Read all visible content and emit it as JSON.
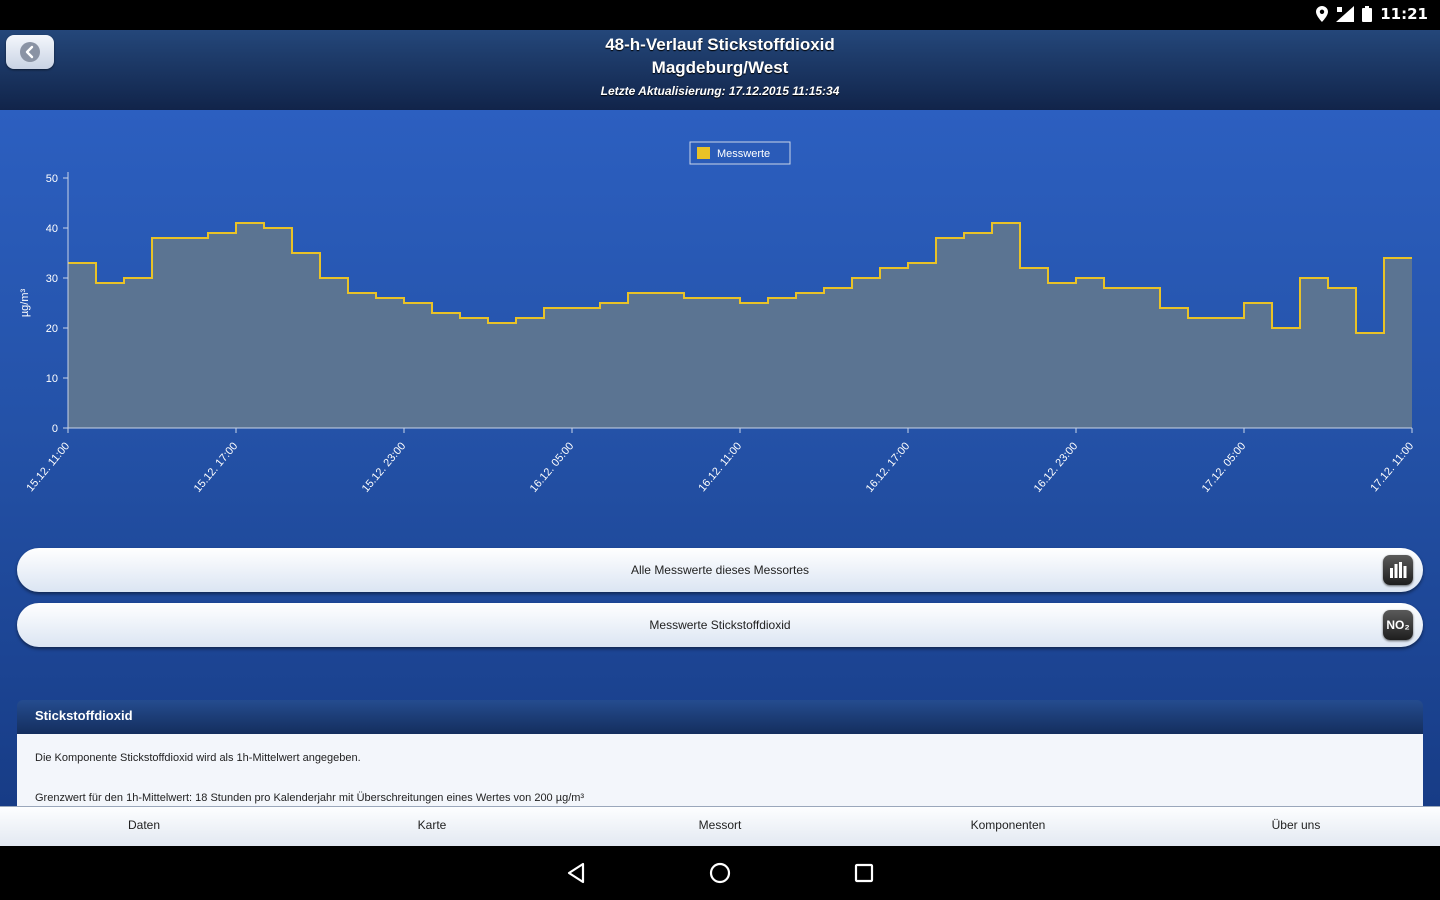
{
  "status_bar": {
    "time": "11:21",
    "icons": [
      "location-icon",
      "signal-icon",
      "battery-icon"
    ]
  },
  "header": {
    "title_line1": "48-h-Verlauf Stickstoffdioxid",
    "title_line2": "Magdeburg/West",
    "last_update": "Letzte Aktualisierung: 17.12.2015 11:15:34",
    "back_icon": "back-arrow-icon"
  },
  "chart_data": {
    "type": "line",
    "step": true,
    "legend": {
      "label": "Messwerte",
      "position": "top-center"
    },
    "series": [
      {
        "name": "Messwerte",
        "color": "#e9c227",
        "fill": "#5b7492",
        "values": [
          33,
          29,
          30,
          38,
          38,
          39,
          41,
          40,
          35,
          30,
          27,
          26,
          25,
          23,
          22,
          21,
          22,
          24,
          24,
          25,
          27,
          27,
          26,
          26,
          25,
          26,
          27,
          28,
          30,
          32,
          33,
          38,
          39,
          41,
          32,
          29,
          30,
          28,
          28,
          24,
          22,
          22,
          25,
          20,
          30,
          28,
          19,
          34
        ]
      }
    ],
    "ylabel": "µg/m³",
    "ylim": [
      0,
      50
    ],
    "yticks": [
      0,
      10,
      20,
      30,
      40,
      50
    ],
    "xtick_labels": [
      "15.12. 11:00",
      "15.12. 17:00",
      "15.12. 23:00",
      "16.12. 05:00",
      "16.12. 11:00",
      "16.12. 17:00",
      "16.12. 23:00",
      "17.12. 05:00",
      "17.12. 11:00"
    ],
    "xtick_hour_index": [
      0,
      6,
      12,
      18,
      24,
      30,
      36,
      42,
      48
    ],
    "grid": false
  },
  "actions": [
    {
      "label": "Alle Messwerte dieses Messortes",
      "icon": "bar-chart-icon"
    },
    {
      "label": "Messwerte Stickstoffdioxid",
      "icon": "no2-icon",
      "icon_text": "NO₂"
    }
  ],
  "info": {
    "title": "Stickstoffdioxid",
    "text1": "Die Komponente Stickstoffdioxid wird als 1h-Mittelwert angegeben.",
    "text2": "Grenzwert für den 1h-Mittelwert: 18 Stunden pro Kalenderjahr mit Überschreitungen eines Wertes von 200 µg/m³"
  },
  "tabs": [
    "Daten",
    "Karte",
    "Messort",
    "Komponenten",
    "Über uns"
  ],
  "colors": {
    "header_bg": "#1a3463",
    "content_bg": "#2a5bb8",
    "series_line": "#e9c227",
    "series_fill": "#5b7492"
  }
}
